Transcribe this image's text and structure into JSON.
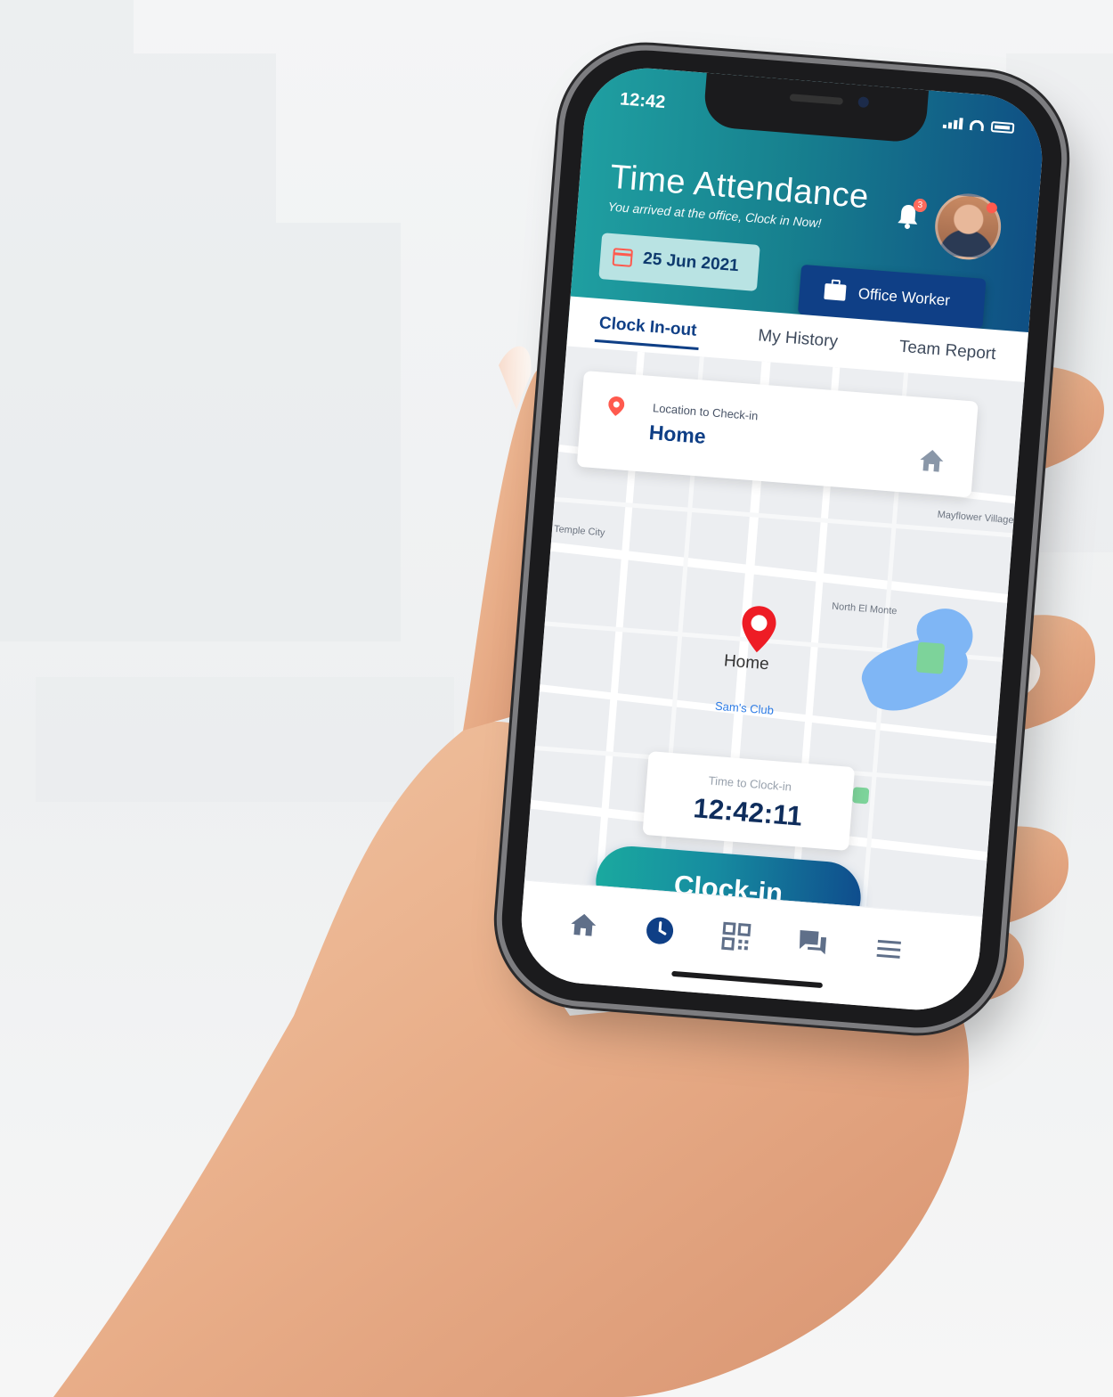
{
  "status_bar": {
    "time": "12:42"
  },
  "header": {
    "title": "Time Attendance",
    "subtitle": "You arrived at the office, Clock in Now!",
    "notification_count": "3",
    "date": "25 Jun 2021",
    "role": "Office Worker"
  },
  "tabs": [
    {
      "label": "Clock In-out",
      "active": true
    },
    {
      "label": "My History",
      "active": false
    },
    {
      "label": "Team Report",
      "active": false
    }
  ],
  "location_card": {
    "label": "Location to Check-in",
    "name": "Home"
  },
  "map": {
    "pin_caption": "Home",
    "place_label": "Sam's Club",
    "labels": [
      "North El Monte",
      "Temple City",
      "Mayflower Village"
    ]
  },
  "clock_card": {
    "label": "Time to Clock-in",
    "time": "12:42:11"
  },
  "clock_button": {
    "label": "Clock-in"
  },
  "bottom_nav": [
    {
      "icon": "home-icon"
    },
    {
      "icon": "clock-icon",
      "active": true
    },
    {
      "icon": "qr-code-icon"
    },
    {
      "icon": "chat-icon"
    },
    {
      "icon": "menu-icon"
    }
  ],
  "colors": {
    "primary_navy": "#0f3f86",
    "teal": "#1aa99f",
    "alert_red": "#ff5a4e"
  }
}
